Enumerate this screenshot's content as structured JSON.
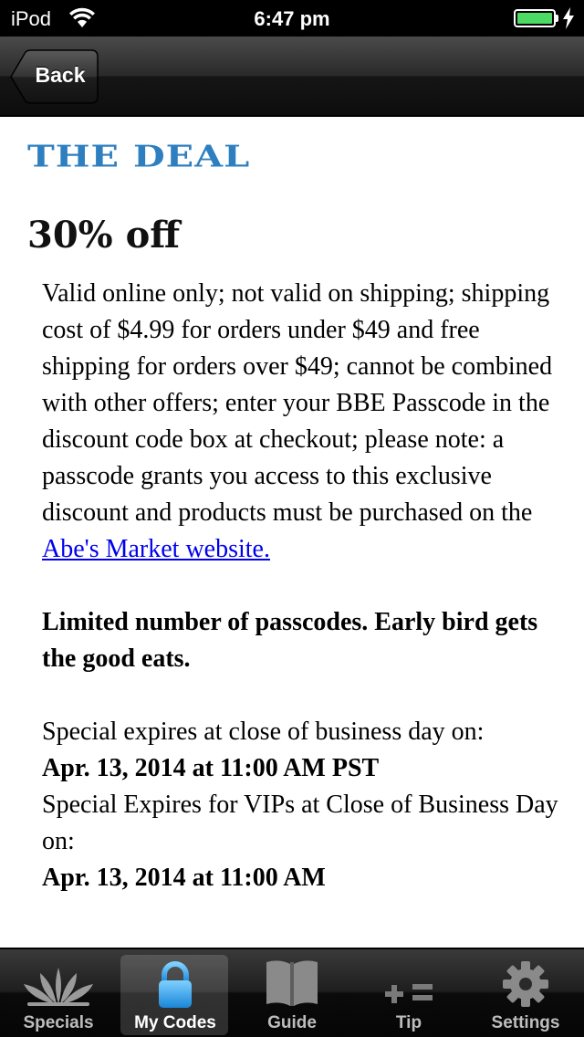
{
  "status_bar": {
    "carrier": "iPod",
    "time": "6:47 pm",
    "battery_level": 1.0,
    "battery_color": "#4cd964",
    "icons": [
      "wifi-icon",
      "battery-icon",
      "charging-bolt-icon"
    ]
  },
  "nav_bar": {
    "back_label": "Back"
  },
  "deal": {
    "section_header": "THE DEAL",
    "header_color": "#2e7fc0",
    "headline": "30% off",
    "terms_text": "Valid online only; not valid on shipping; shipping cost of $4.99 for orders under $49 and free shipping for orders over $49; cannot be combined with other offers; enter your BBE Passcode in the discount code box at checkout; please note: a passcode grants you access to this exclusive discount and products must be purchased on the ",
    "terms_link": "Abe's Market website.",
    "limited_notice": "Limited number of passcodes. Early bird gets the good eats.",
    "expires_label": "Special expires at close of business day on:",
    "expires_date": "Apr. 13, 2014 at 11:00 AM PST",
    "vip_expires_label": "Special Expires for VIPs at Close of Business Day on:",
    "vip_expires_date": "Apr. 13, 2014 at 11:00 AM"
  },
  "tab_bar": {
    "tabs": [
      {
        "label": "Specials",
        "icon": "lotus-icon",
        "selected": false
      },
      {
        "label": "My Codes",
        "icon": "padlock-icon",
        "selected": true
      },
      {
        "label": "Guide",
        "icon": "book-icon",
        "selected": false
      },
      {
        "label": "Tip",
        "icon": "calculator-icon",
        "selected": false
      },
      {
        "label": "Settings",
        "icon": "gear-icon",
        "selected": false
      }
    ],
    "selected_color": "#2ea0ea"
  }
}
